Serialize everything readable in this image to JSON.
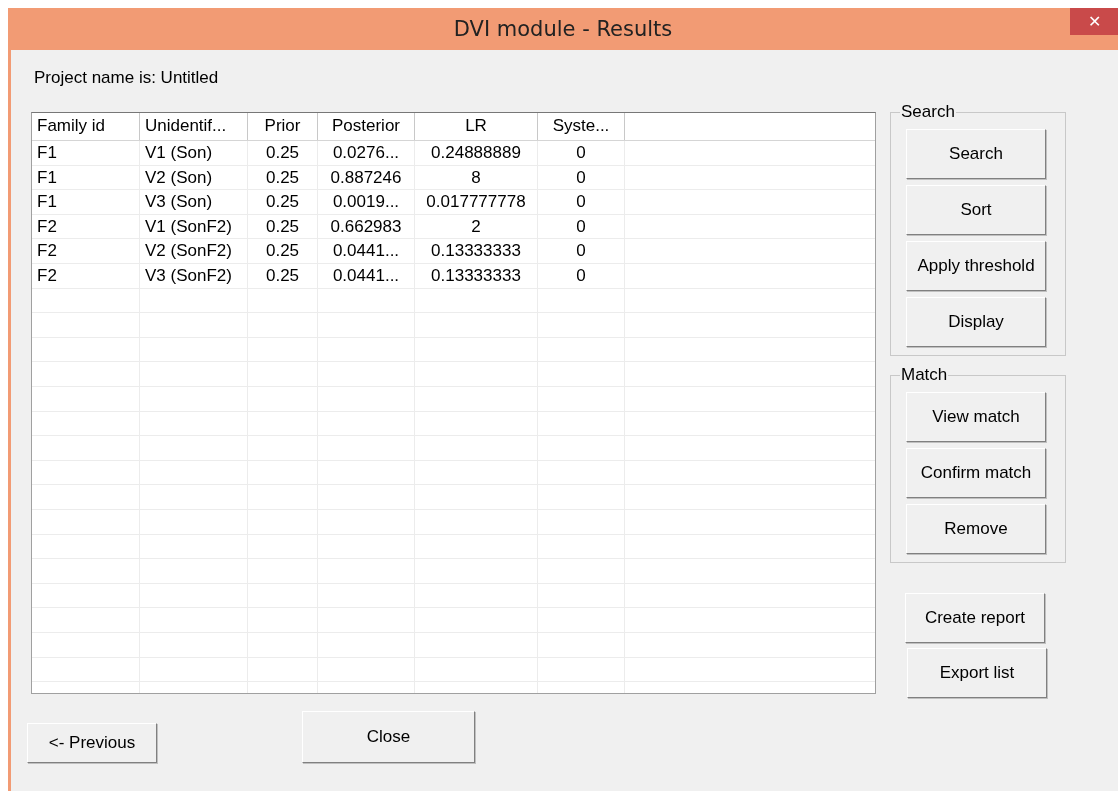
{
  "window": {
    "title": "DVI module - Results",
    "close_glyph": "✕"
  },
  "project_label": "Project name is: Untitled",
  "table": {
    "columns": [
      "Family id",
      "Unidentif...",
      "Prior",
      "Posterior",
      "LR",
      "Syste..."
    ],
    "rows": [
      [
        "F1",
        "V1 (Son)",
        "0.25",
        "0.0276...",
        "0.24888889",
        "0"
      ],
      [
        "F1",
        "V2 (Son)",
        "0.25",
        "0.887246",
        "8",
        "0"
      ],
      [
        "F1",
        "V3 (Son)",
        "0.25",
        "0.0019...",
        "0.017777778",
        "0"
      ],
      [
        "F2",
        "V1 (SonF2)",
        "0.25",
        "0.662983",
        "2",
        "0"
      ],
      [
        "F2",
        "V2 (SonF2)",
        "0.25",
        "0.0441...",
        "0.13333333",
        "0"
      ],
      [
        "F2",
        "V3 (SonF2)",
        "0.25",
        "0.0441...",
        "0.13333333",
        "0"
      ]
    ]
  },
  "groups": [
    {
      "label": "Search",
      "buttons": [
        "Search",
        "Sort",
        "Apply threshold",
        "Display"
      ]
    },
    {
      "label": "Match",
      "buttons": [
        "View match",
        "Confirm match",
        "Remove"
      ]
    }
  ],
  "side_buttons": [
    "Create report",
    "Export list"
  ],
  "bottom_buttons": [
    "<- Previous",
    "Close"
  ]
}
